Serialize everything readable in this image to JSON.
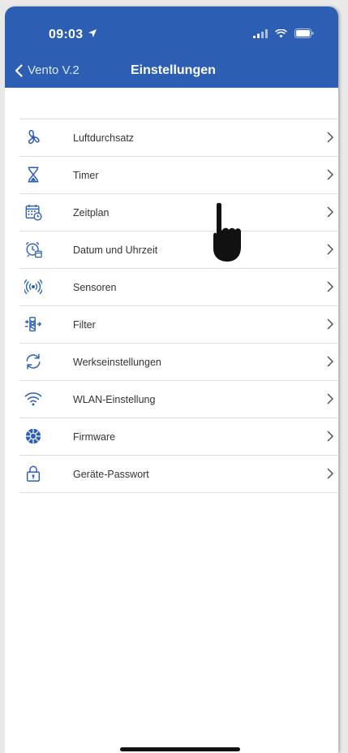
{
  "status": {
    "time": "09:03",
    "location_icon": "location-arrow-icon",
    "signal_icon": "cellular-signal-icon",
    "wifi_icon": "wifi-status-icon",
    "battery_icon": "battery-icon"
  },
  "nav": {
    "back_label": "Vento V.2",
    "title": "Einstellungen"
  },
  "colors": {
    "header": "#2c5fb3",
    "icon": "#2c5fb3",
    "text": "#333333",
    "divider": "#dedede"
  },
  "settings": [
    {
      "label": "Luftdurchsatz",
      "icon": "fan-icon"
    },
    {
      "label": "Timer",
      "icon": "hourglass-icon"
    },
    {
      "label": "Zeitplan",
      "icon": "calendar-clock-icon"
    },
    {
      "label": "Datum und Uhrzeit",
      "icon": "alarm-clock-icon"
    },
    {
      "label": "Sensoren",
      "icon": "sensor-waves-icon"
    },
    {
      "label": "Filter",
      "icon": "filter-icon"
    },
    {
      "label": "Werkseinstellungen",
      "icon": "reset-arrows-icon"
    },
    {
      "label": "WLAN-Einstellung",
      "icon": "wifi-icon"
    },
    {
      "label": "Firmware",
      "icon": "chip-globe-icon"
    },
    {
      "label": "Geräte-Passwort",
      "icon": "padlock-icon"
    }
  ]
}
